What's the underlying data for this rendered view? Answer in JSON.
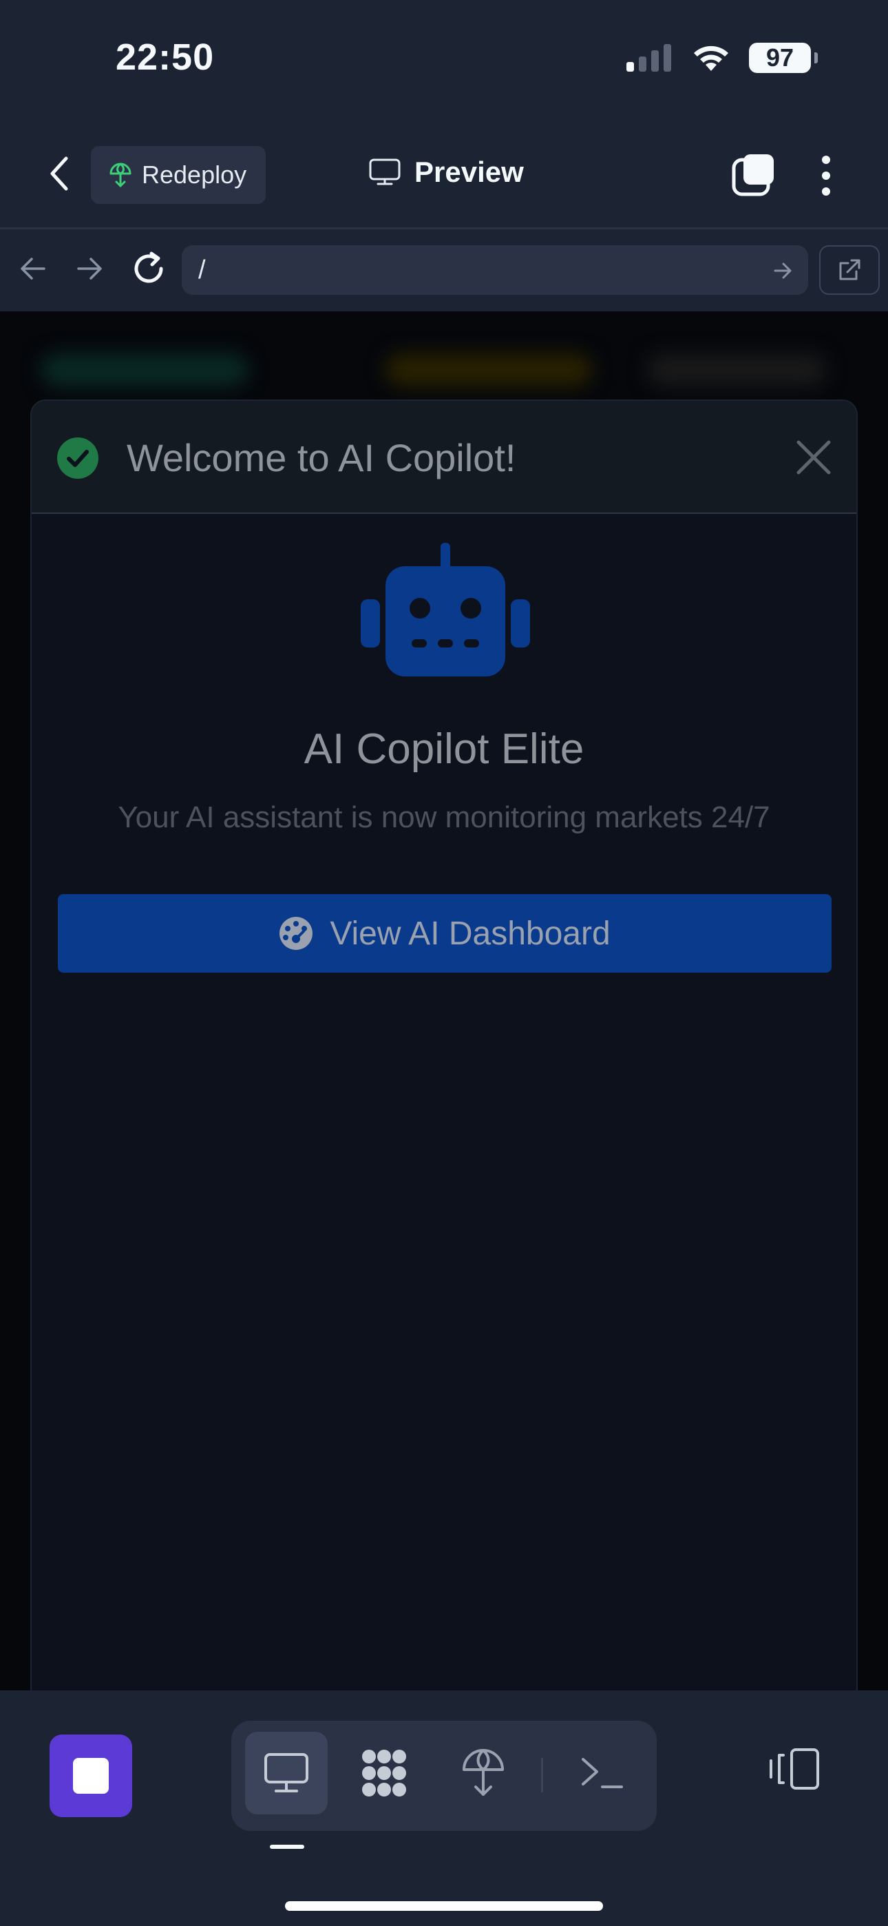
{
  "status_bar": {
    "time": "22:50",
    "battery": "97"
  },
  "header": {
    "redeploy_label": "Redeploy",
    "preview_label": "Preview"
  },
  "url_bar": {
    "value": "/"
  },
  "modal": {
    "title": "Welcome to AI Copilot!",
    "heading": "AI Copilot Elite",
    "subtitle": "Your AI assistant is now monitoring markets 24/7",
    "button_label": "View AI Dashboard"
  },
  "toolbar": {
    "tools": [
      "monitor-icon",
      "workspace-grid-icon",
      "deploy-icon",
      "terminal-icon"
    ],
    "active_tool": "monitor-icon"
  },
  "colors": {
    "background": "#1c2333",
    "accent_purple": "#5b3ad6",
    "button_blue": "#0a3a8c",
    "success_green": "#1f7a45",
    "redeploy_green": "#3ccf7a"
  }
}
